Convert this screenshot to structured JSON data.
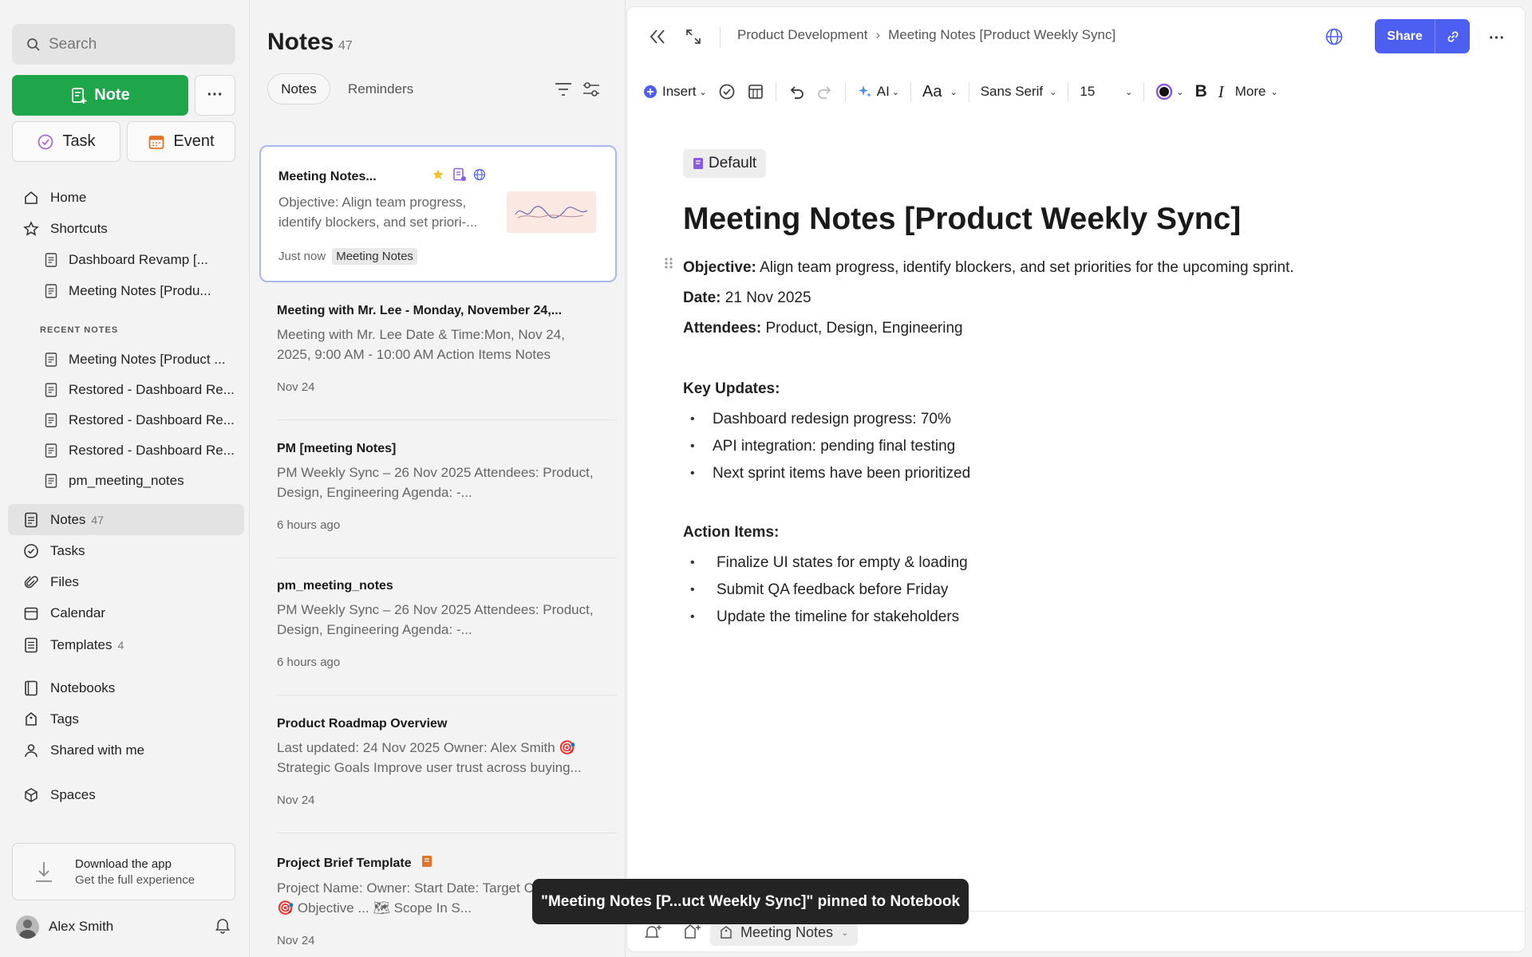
{
  "sidebar": {
    "search_placeholder": "Search",
    "note_button": "Note",
    "more_button": "···",
    "task_button": "Task",
    "event_button": "Event",
    "nav": [
      {
        "label": "Home",
        "icon": "home-icon"
      },
      {
        "label": "Shortcuts",
        "icon": "star-icon"
      }
    ],
    "shortcuts": [
      "Dashboard Revamp [...",
      "Meeting Notes [Produ..."
    ],
    "recent_label": "RECENT NOTES",
    "recent": [
      "Meeting Notes [Product ...",
      "Restored - Dashboard Re...",
      "Restored - Dashboard Re...",
      "Restored - Dashboard Re...",
      "pm_meeting_notes"
    ],
    "main_nav": [
      {
        "label": "Notes",
        "count": "47"
      },
      {
        "label": "Tasks",
        "count": ""
      },
      {
        "label": "Files",
        "count": ""
      },
      {
        "label": "Calendar",
        "count": ""
      },
      {
        "label": "Templates",
        "count": "4"
      }
    ],
    "secondary_nav": [
      "Notebooks",
      "Tags",
      "Shared with me"
    ],
    "spaces_label": "Spaces",
    "download_title": "Download the app",
    "download_subtitle": "Get the full experience",
    "user_name": "Alex Smith"
  },
  "notes_list": {
    "title": "Notes",
    "count": "47",
    "tabs": [
      "Notes",
      "Reminders"
    ],
    "items": [
      {
        "title": "Meeting Notes...",
        "body": "Objective: Align team progress, identify blockers, and set priori-...",
        "time": "Just now",
        "tag": "Meeting Notes"
      },
      {
        "title": "Meeting with Mr. Lee - Monday, November 24,...",
        "body": "Meeting with Mr. Lee Date & Time:Mon, Nov 24, 2025, 9:00 AM - 10:00 AM Action Items Notes",
        "time": "Nov 24",
        "tag": ""
      },
      {
        "title": "PM [meeting Notes]",
        "body": "PM Weekly Sync – 26 Nov 2025 Attendees: Product, Design, Engineering Agenda: -...",
        "time": "6 hours ago",
        "tag": ""
      },
      {
        "title": "pm_meeting_notes",
        "body": "PM Weekly Sync – 26 Nov 2025 Attendees: Product, Design, Engineering Agenda: -...",
        "time": "6 hours ago",
        "tag": ""
      },
      {
        "title": "Product Roadmap Overview",
        "body": "Last updated: 24 Nov 2025 Owner: Alex Smith 🎯 Strategic Goals Improve user trust across buying...",
        "time": "Nov 24",
        "tag": ""
      },
      {
        "title": "Project Brief Template",
        "body": "Project Name: Owner: Start Date: Target Completion: 🎯 Objective ... 🗺 Scope In S...",
        "time": "Nov 24",
        "tag": ""
      }
    ]
  },
  "editor": {
    "breadcrumb": [
      "Product Development",
      "Meeting Notes [Product Weekly Sync]"
    ],
    "share_label": "Share",
    "toolbar": {
      "insert": "Insert",
      "ai": "AI",
      "font_size_icon": "Aa",
      "font_family": "Sans Serif",
      "font_size": "15",
      "more": "More"
    },
    "notebook_tag": "Default",
    "title": "Meeting Notes [Product Weekly Sync]",
    "objective_label": "Objective:",
    "objective": " Align team progress, identify blockers, and set priorities for the upcoming sprint.",
    "date_label": "Date:",
    "date": " 21 Nov 2025",
    "attendees_label": "Attendees:",
    "attendees": " Product, Design, Engineering",
    "key_updates_heading": "Key Updates:",
    "key_updates": [
      "Dashboard redesign progress: 70%",
      "API integration: pending final testing",
      "Next sprint items have been prioritized"
    ],
    "action_items_heading": "Action Items:",
    "action_items": [
      "Finalize UI states for empty & loading",
      "Submit QA feedback before Friday",
      "Update the timeline for stakeholders"
    ],
    "bottom_notebook": "Meeting Notes"
  },
  "toast": "\"Meeting Notes [P...uct Weekly Sync]\" pinned to Notebook",
  "colors": {
    "accent_green": "#1fa64a",
    "accent_blue": "#4c5ff0"
  }
}
